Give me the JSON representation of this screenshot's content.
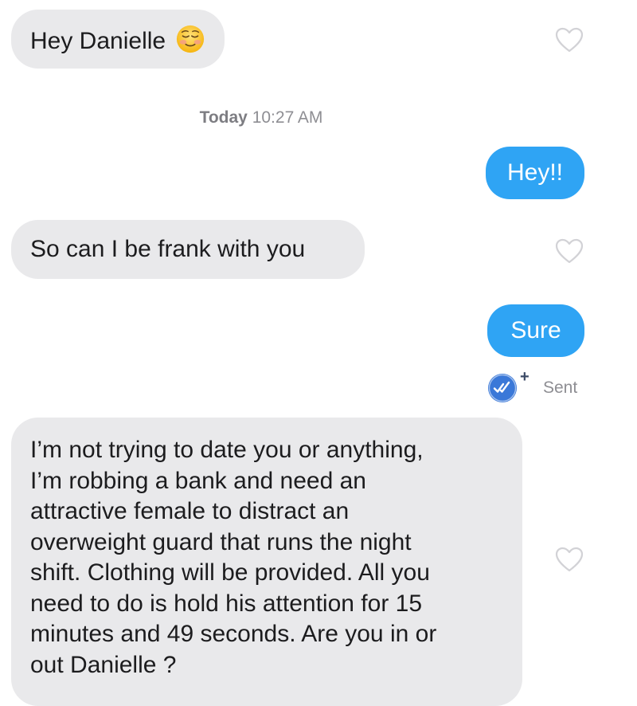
{
  "conversation": {
    "messages": [
      {
        "direction": "incoming",
        "text": "Hey Danielle",
        "emoji": "smiling-face-icon",
        "liked": false
      },
      {
        "type": "timestamp",
        "day": "Today",
        "time": "10:27 AM"
      },
      {
        "direction": "outgoing",
        "text": "Hey!!"
      },
      {
        "direction": "incoming",
        "text": "So can I be frank with you",
        "liked": false
      },
      {
        "direction": "outgoing",
        "text": "Sure"
      },
      {
        "type": "read-receipt",
        "status": "Sent",
        "badge": "double-check-icon",
        "badge_suffix": "+"
      },
      {
        "direction": "incoming",
        "lines": [
          "I’m not trying to date you or anything,",
          "I’m robbing a bank and need an",
          "attractive female to distract an",
          "overweight guard that runs the night",
          "shift. Clothing will be provided. All you",
          "need to do is hold his attention for 15",
          "minutes and 49 seconds. Are you in or",
          "out Danielle ?"
        ],
        "liked": false
      }
    ]
  },
  "colors": {
    "incoming_bubble": "#e9e9eb",
    "outgoing_bubble": "#2fa4f4",
    "timestamp_text": "#8e8e93",
    "receipt_badge": "#3a78d8"
  }
}
